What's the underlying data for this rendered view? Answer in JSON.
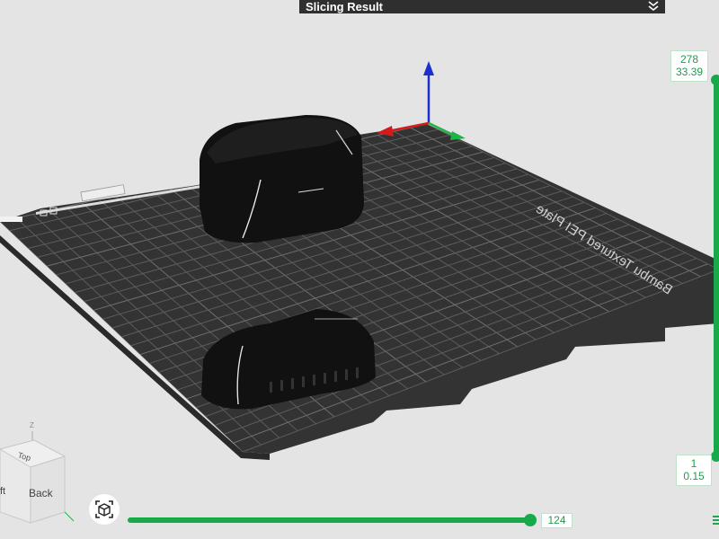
{
  "header": {
    "title": "Slicing Result",
    "collapse_icon": "chevron-double-down-icon"
  },
  "layer_slider": {
    "top_layer": "278",
    "top_height": "33.39",
    "bottom_layer": "1",
    "bottom_height": "0.15"
  },
  "move_slider": {
    "value": "124"
  },
  "bed": {
    "text": "Bambu Textured PEI Plate"
  },
  "nav_cube": {
    "top": "Top",
    "back": "Back",
    "left_partial": "ft",
    "axis_z": "Z"
  },
  "camera_icon": "view-cube-icon",
  "colors": {
    "accent": "#17a94a",
    "bed": "#333333",
    "grid": "#5a5a5a",
    "model": "#141414"
  }
}
